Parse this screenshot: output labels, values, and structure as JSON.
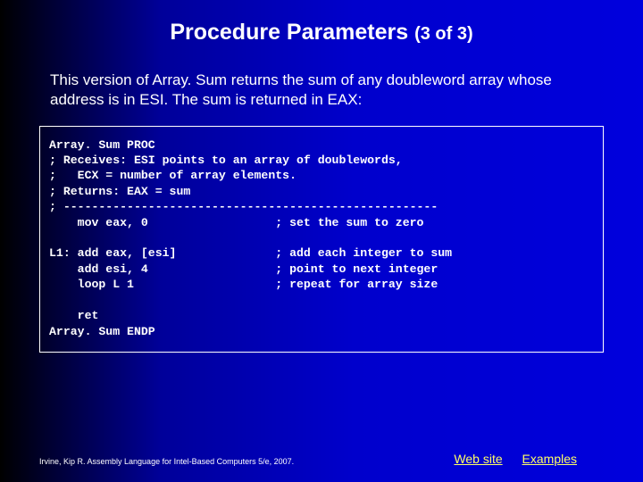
{
  "title": {
    "main": "Procedure Parameters",
    "sub": "(3 of 3)"
  },
  "description": "This version of Array. Sum returns the sum of any doubleword array whose address is in ESI. The sum is returned in EAX:",
  "code": "Array. Sum PROC\n; Receives: ESI points to an array of doublewords,\n;   ECX = number of array elements.\n; Returns: EAX = sum\n; -----------------------------------------------------\n    mov eax, 0                  ; set the sum to zero\n\nL1: add eax, [esi]              ; add each integer to sum\n    add esi, 4                  ; point to next integer\n    loop L 1                    ; repeat for array size\n\n    ret\nArray. Sum ENDP",
  "footer": {
    "credit": "Irvine, Kip R. Assembly Language for Intel-Based Computers 5/e, 2007.",
    "link_web": "Web site",
    "link_examples": "Examples"
  }
}
